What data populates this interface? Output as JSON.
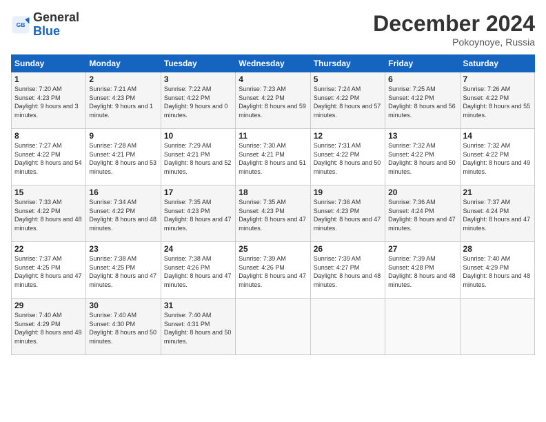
{
  "header": {
    "logo_line1": "General",
    "logo_line2": "Blue",
    "month_year": "December 2024",
    "location": "Pokoynoye, Russia"
  },
  "weekdays": [
    "Sunday",
    "Monday",
    "Tuesday",
    "Wednesday",
    "Thursday",
    "Friday",
    "Saturday"
  ],
  "rows": [
    [
      {
        "day": "1",
        "sunrise": "7:20 AM",
        "sunset": "4:23 PM",
        "daylight": "9 hours and 3 minutes."
      },
      {
        "day": "2",
        "sunrise": "7:21 AM",
        "sunset": "4:23 PM",
        "daylight": "9 hours and 1 minute."
      },
      {
        "day": "3",
        "sunrise": "7:22 AM",
        "sunset": "4:22 PM",
        "daylight": "9 hours and 0 minutes."
      },
      {
        "day": "4",
        "sunrise": "7:23 AM",
        "sunset": "4:22 PM",
        "daylight": "8 hours and 59 minutes."
      },
      {
        "day": "5",
        "sunrise": "7:24 AM",
        "sunset": "4:22 PM",
        "daylight": "8 hours and 57 minutes."
      },
      {
        "day": "6",
        "sunrise": "7:25 AM",
        "sunset": "4:22 PM",
        "daylight": "8 hours and 56 minutes."
      },
      {
        "day": "7",
        "sunrise": "7:26 AM",
        "sunset": "4:22 PM",
        "daylight": "8 hours and 55 minutes."
      }
    ],
    [
      {
        "day": "8",
        "sunrise": "7:27 AM",
        "sunset": "4:22 PM",
        "daylight": "8 hours and 54 minutes."
      },
      {
        "day": "9",
        "sunrise": "7:28 AM",
        "sunset": "4:21 PM",
        "daylight": "8 hours and 53 minutes."
      },
      {
        "day": "10",
        "sunrise": "7:29 AM",
        "sunset": "4:21 PM",
        "daylight": "8 hours and 52 minutes."
      },
      {
        "day": "11",
        "sunrise": "7:30 AM",
        "sunset": "4:21 PM",
        "daylight": "8 hours and 51 minutes."
      },
      {
        "day": "12",
        "sunrise": "7:31 AM",
        "sunset": "4:22 PM",
        "daylight": "8 hours and 50 minutes."
      },
      {
        "day": "13",
        "sunrise": "7:32 AM",
        "sunset": "4:22 PM",
        "daylight": "8 hours and 50 minutes."
      },
      {
        "day": "14",
        "sunrise": "7:32 AM",
        "sunset": "4:22 PM",
        "daylight": "8 hours and 49 minutes."
      }
    ],
    [
      {
        "day": "15",
        "sunrise": "7:33 AM",
        "sunset": "4:22 PM",
        "daylight": "8 hours and 48 minutes."
      },
      {
        "day": "16",
        "sunrise": "7:34 AM",
        "sunset": "4:22 PM",
        "daylight": "8 hours and 48 minutes."
      },
      {
        "day": "17",
        "sunrise": "7:35 AM",
        "sunset": "4:23 PM",
        "daylight": "8 hours and 47 minutes."
      },
      {
        "day": "18",
        "sunrise": "7:35 AM",
        "sunset": "4:23 PM",
        "daylight": "8 hours and 47 minutes."
      },
      {
        "day": "19",
        "sunrise": "7:36 AM",
        "sunset": "4:23 PM",
        "daylight": "8 hours and 47 minutes."
      },
      {
        "day": "20",
        "sunrise": "7:36 AM",
        "sunset": "4:24 PM",
        "daylight": "8 hours and 47 minutes."
      },
      {
        "day": "21",
        "sunrise": "7:37 AM",
        "sunset": "4:24 PM",
        "daylight": "8 hours and 47 minutes."
      }
    ],
    [
      {
        "day": "22",
        "sunrise": "7:37 AM",
        "sunset": "4:25 PM",
        "daylight": "8 hours and 47 minutes."
      },
      {
        "day": "23",
        "sunrise": "7:38 AM",
        "sunset": "4:25 PM",
        "daylight": "8 hours and 47 minutes."
      },
      {
        "day": "24",
        "sunrise": "7:38 AM",
        "sunset": "4:26 PM",
        "daylight": "8 hours and 47 minutes."
      },
      {
        "day": "25",
        "sunrise": "7:39 AM",
        "sunset": "4:26 PM",
        "daylight": "8 hours and 47 minutes."
      },
      {
        "day": "26",
        "sunrise": "7:39 AM",
        "sunset": "4:27 PM",
        "daylight": "8 hours and 48 minutes."
      },
      {
        "day": "27",
        "sunrise": "7:39 AM",
        "sunset": "4:28 PM",
        "daylight": "8 hours and 48 minutes."
      },
      {
        "day": "28",
        "sunrise": "7:40 AM",
        "sunset": "4:29 PM",
        "daylight": "8 hours and 48 minutes."
      }
    ],
    [
      {
        "day": "29",
        "sunrise": "7:40 AM",
        "sunset": "4:29 PM",
        "daylight": "8 hours and 49 minutes."
      },
      {
        "day": "30",
        "sunrise": "7:40 AM",
        "sunset": "4:30 PM",
        "daylight": "8 hours and 50 minutes."
      },
      {
        "day": "31",
        "sunrise": "7:40 AM",
        "sunset": "4:31 PM",
        "daylight": "8 hours and 50 minutes."
      },
      null,
      null,
      null,
      null
    ]
  ]
}
